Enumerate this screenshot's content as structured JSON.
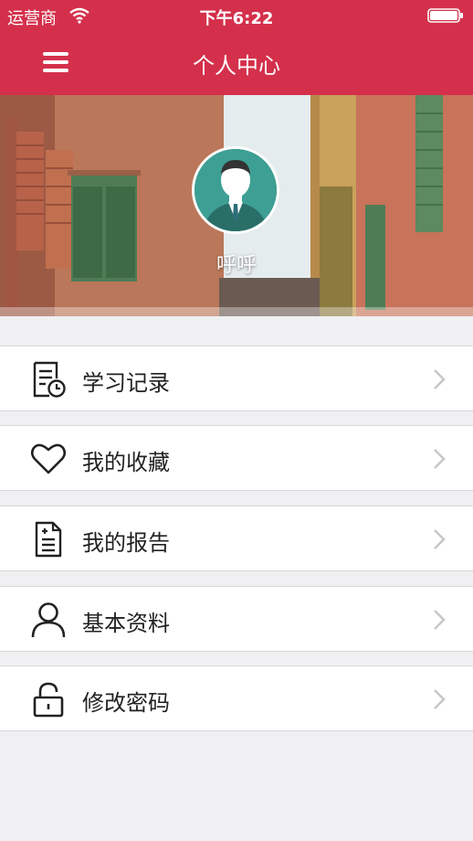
{
  "status_bar": {
    "carrier": "运营商",
    "time": "下午6:22"
  },
  "nav": {
    "title": "个人中心",
    "menu_icon": "hamburger-menu-icon"
  },
  "profile": {
    "name": "呼呼",
    "avatar_icon": "user-avatar-icon"
  },
  "menu": {
    "items": [
      {
        "label": "学习记录",
        "icon": "study-record-icon"
      },
      {
        "label": "我的收藏",
        "icon": "heart-icon"
      },
      {
        "label": "我的报告",
        "icon": "report-icon"
      },
      {
        "label": "基本资料",
        "icon": "person-icon"
      },
      {
        "label": "修改密码",
        "icon": "lock-icon"
      }
    ]
  },
  "colors": {
    "accent": "#d4304b",
    "background": "#f0f0f2"
  }
}
